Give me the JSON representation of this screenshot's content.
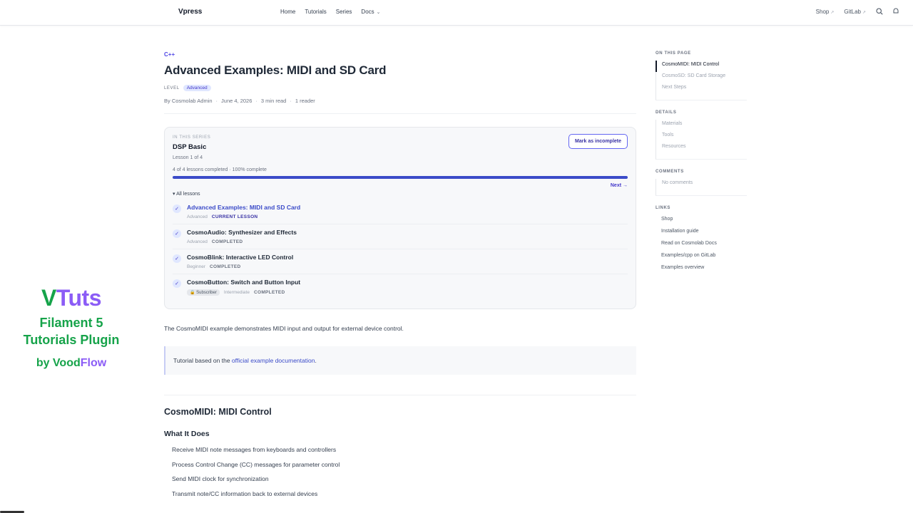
{
  "topbar": {
    "brand": "Vpress",
    "nav": [
      {
        "label": "Home"
      },
      {
        "label": "Tutorials"
      },
      {
        "label": "Series"
      },
      {
        "label": "Docs"
      }
    ],
    "right": [
      {
        "label": "Shop",
        "ext": "↗"
      },
      {
        "label": "GitLab",
        "ext": "↗"
      }
    ]
  },
  "promo": {
    "logo_v": "V",
    "logo_rest": "Tuts",
    "line1": "Filament 5",
    "line2": "Tutorials Plugin",
    "by": "by Vood",
    "by_flow": "Flow",
    "colors": {
      "green": "#16a34a",
      "purple": "#8b5cf6"
    }
  },
  "article": {
    "category": "C++",
    "title": "Advanced Examples: MIDI and SD Card",
    "level_label": "LEVEL",
    "level": "Advanced",
    "author": "By Cosmolab Admin",
    "date": "June 4, 2026",
    "read_time": "3 min read",
    "readers": "1 reader",
    "intro": "The CosmoMIDI example demonstrates MIDI input and output for external device control.",
    "callout_prefix": "Tutorial based on the ",
    "callout_link": "official example documentation",
    "callout_suffix": ".",
    "section_title": "CosmoMIDI: MIDI Control",
    "subsection_title": "What It Does",
    "bullets": [
      "Receive MIDI note messages from keyboards and controllers",
      "Process Control Change (CC) messages for parameter control",
      "Send MIDI clock for synchronization",
      "Transmit note/CC information back to external devices"
    ]
  },
  "series": {
    "kicker": "IN THIS SERIES",
    "title": "DSP Basic",
    "lesson_pos": "Lesson 1 of 4",
    "progress_text": "4 of 4 lessons completed · 100% complete",
    "progress": 1.0,
    "mark_button": "Mark as incomplete",
    "next": "Next →",
    "all_lessons": "▾ All lessons",
    "lessons": [
      {
        "title": "Advanced Examples: MIDI and SD Card",
        "level": "Advanced",
        "status": "CURRENT LESSON",
        "badge": ""
      },
      {
        "title": "CosmoAudio: Synthesizer and Effects",
        "level": "Advanced",
        "status": "COMPLETED",
        "badge": ""
      },
      {
        "title": "CosmoBlink: Interactive LED Control",
        "level": "Beginner",
        "status": "COMPLETED",
        "badge": ""
      },
      {
        "title": "CosmoButton: Switch and Button Input",
        "level": "Intermediate",
        "status": "COMPLETED",
        "badge": "🔒 Subscriber"
      }
    ]
  },
  "sidebar": {
    "on_this_page_title": "ON THIS PAGE",
    "on_this_page": [
      "CosmoMIDI: MIDI Control",
      "CosmoSD: SD Card Storage",
      "Next Steps"
    ],
    "details_title": "DETAILS",
    "details": [
      "Materials",
      "Tools",
      "Resources"
    ],
    "comments_title": "COMMENTS",
    "comments": [
      "No comments"
    ],
    "links_title": "LINKS",
    "links": [
      "Shop",
      "Installation guide",
      "Read on Cosmolab Docs",
      "Examples/cpp on GitLab",
      "Examples overview"
    ]
  }
}
